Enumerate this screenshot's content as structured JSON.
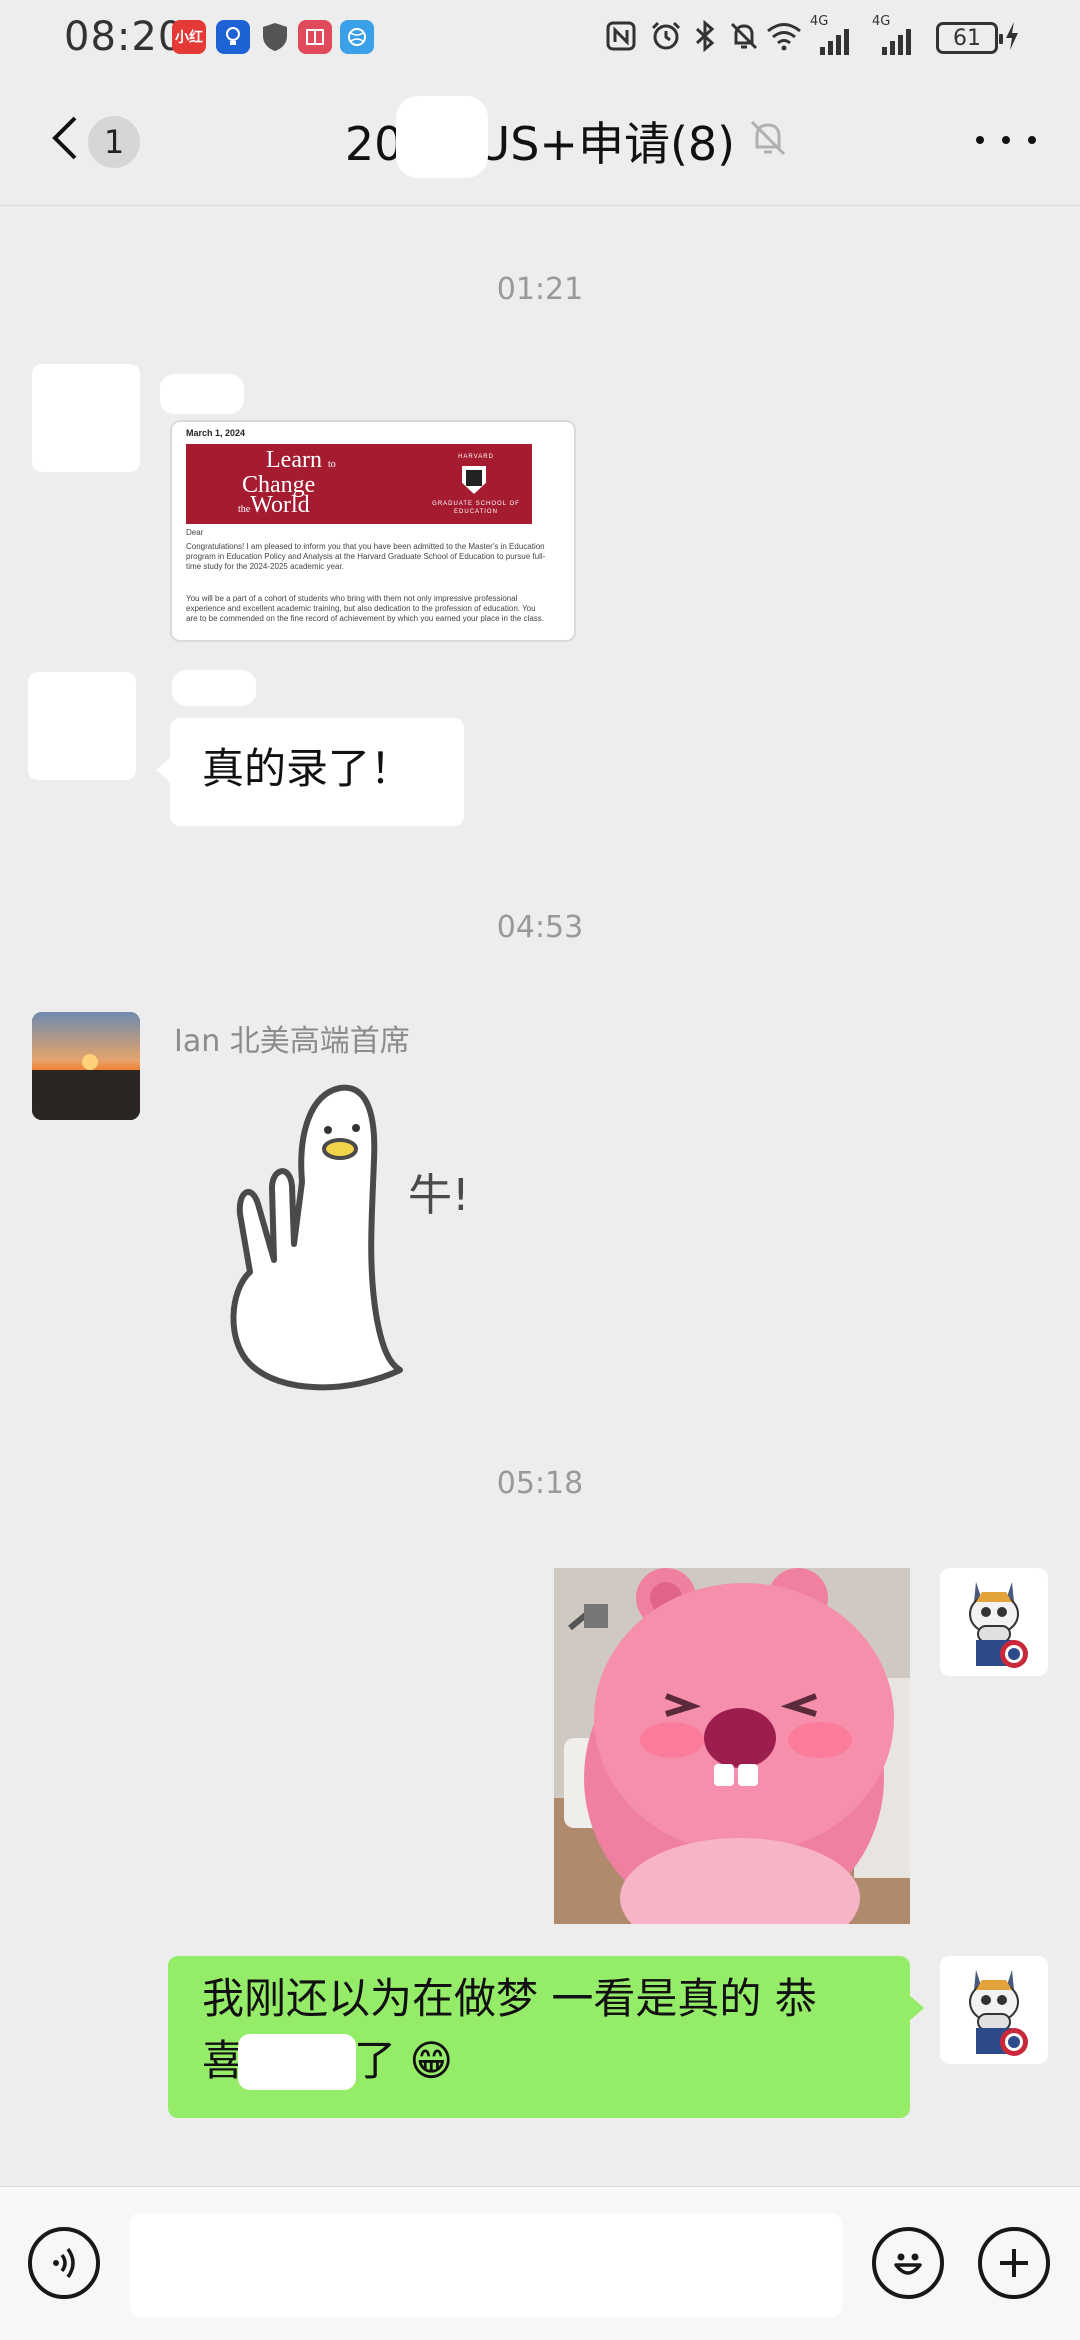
{
  "status_bar": {
    "time": "08:20",
    "battery": "61",
    "network_1": "4G",
    "network_2": "4G"
  },
  "nav": {
    "unread_count": "1",
    "title": "2024      US+申请(8)"
  },
  "messages": [
    {
      "type": "timestamp",
      "text": "01:21"
    },
    {
      "type": "image-letter",
      "letter_date": "March 1, 2024",
      "banner_line1": "Learn",
      "banner_line1_small": "to",
      "banner_line2": "Change",
      "banner_line3_small": "the",
      "banner_line3": "World",
      "crest_label": "HARVARD",
      "crest_label2": "GRADUATE SCHOOL OF EDUCATION",
      "salutation": "Dear",
      "paragraph1": "Congratulations! I am pleased to inform you that you have been admitted to the Master's in Education program in Education Policy and Analysis at the Harvard Graduate School of Education to pursue full-time study for the 2024-2025 academic year.",
      "paragraph2": "You will be a part of a cohort of students who bring with them not only impressive professional experience and excellent academic training, but also dedication to the profession of education. You are to be commended on the fine record of achievement by which you earned your place in the class."
    },
    {
      "type": "text-in",
      "text": "真的录了！"
    },
    {
      "type": "timestamp",
      "text": "04:53"
    },
    {
      "type": "sticker-in",
      "sender": "Ian 北美高端首席",
      "sticker_text": "牛!"
    },
    {
      "type": "timestamp",
      "text": "05:18"
    },
    {
      "type": "sticker-out"
    },
    {
      "type": "text-out",
      "line1": "我刚还以为在做梦 一看是真的 恭",
      "line2_prefix": "喜",
      "line2_suffix": "了 😁"
    }
  ],
  "input": {
    "placeholder": ""
  },
  "colors": {
    "background": "#ededed",
    "bubble_out": "#95ec69",
    "bubble_in": "#ffffff",
    "harvard_crimson": "#a51c30"
  }
}
